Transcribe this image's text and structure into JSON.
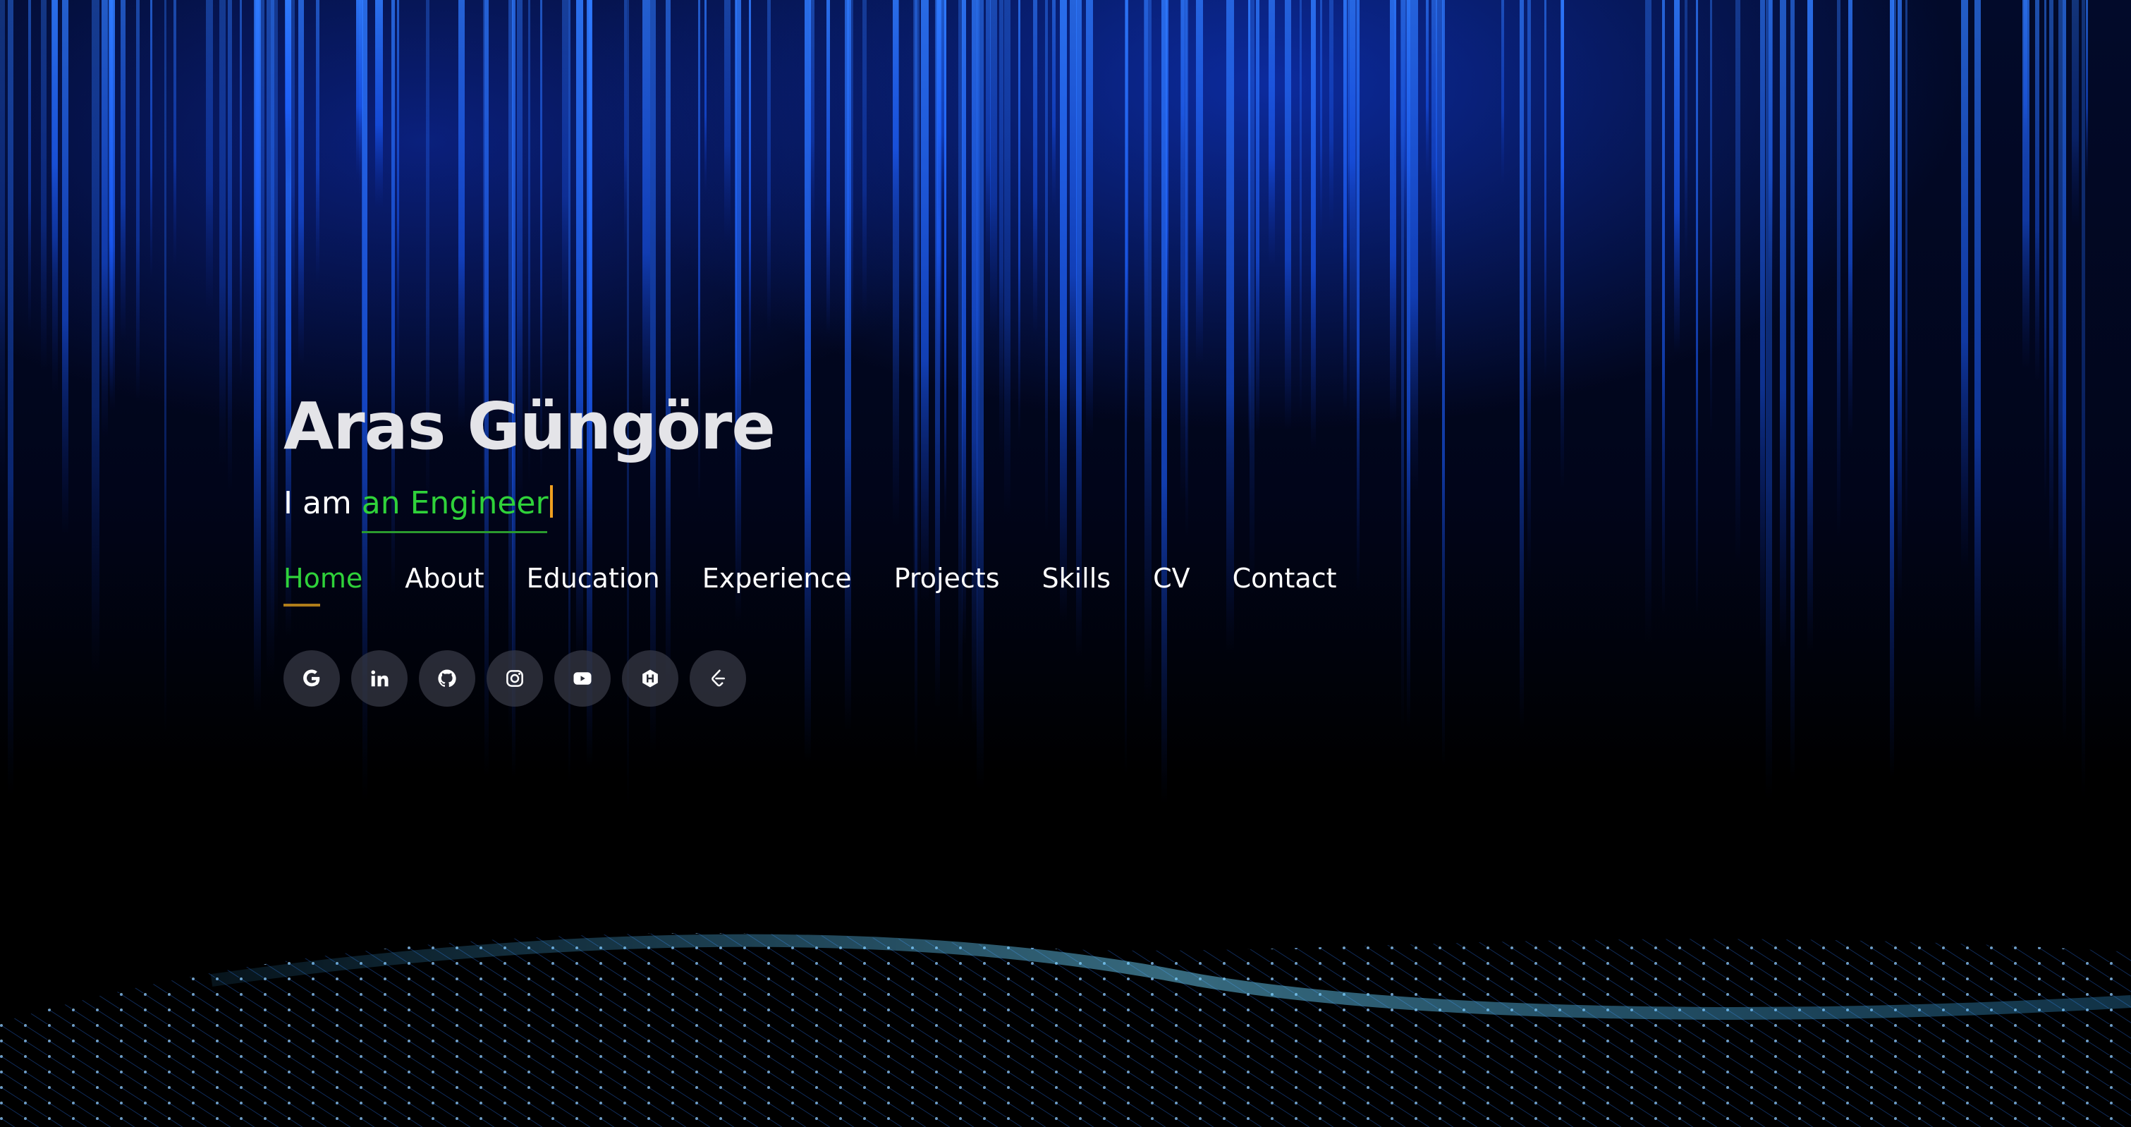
{
  "hero": {
    "name": "Aras Güngöre",
    "subtitle_prefix": "I am ",
    "subtitle_typed": "an Engineer"
  },
  "nav": {
    "items": [
      "Home",
      "About",
      "Education",
      "Experience",
      "Projects",
      "Skills",
      "CV",
      "Contact"
    ],
    "active": "Home"
  },
  "social": {
    "icons": [
      "google-icon",
      "linkedin-icon",
      "github-icon",
      "instagram-icon",
      "youtube-icon",
      "hackerrank-icon",
      "leetcode-icon"
    ]
  },
  "colors": {
    "accent_green": "#2fd23a",
    "underline_gold": "#b07d1a",
    "caret_orange": "#f0a020",
    "matrix_blue": "#1e6bff",
    "wave_cyan": "#3fb6ff"
  }
}
